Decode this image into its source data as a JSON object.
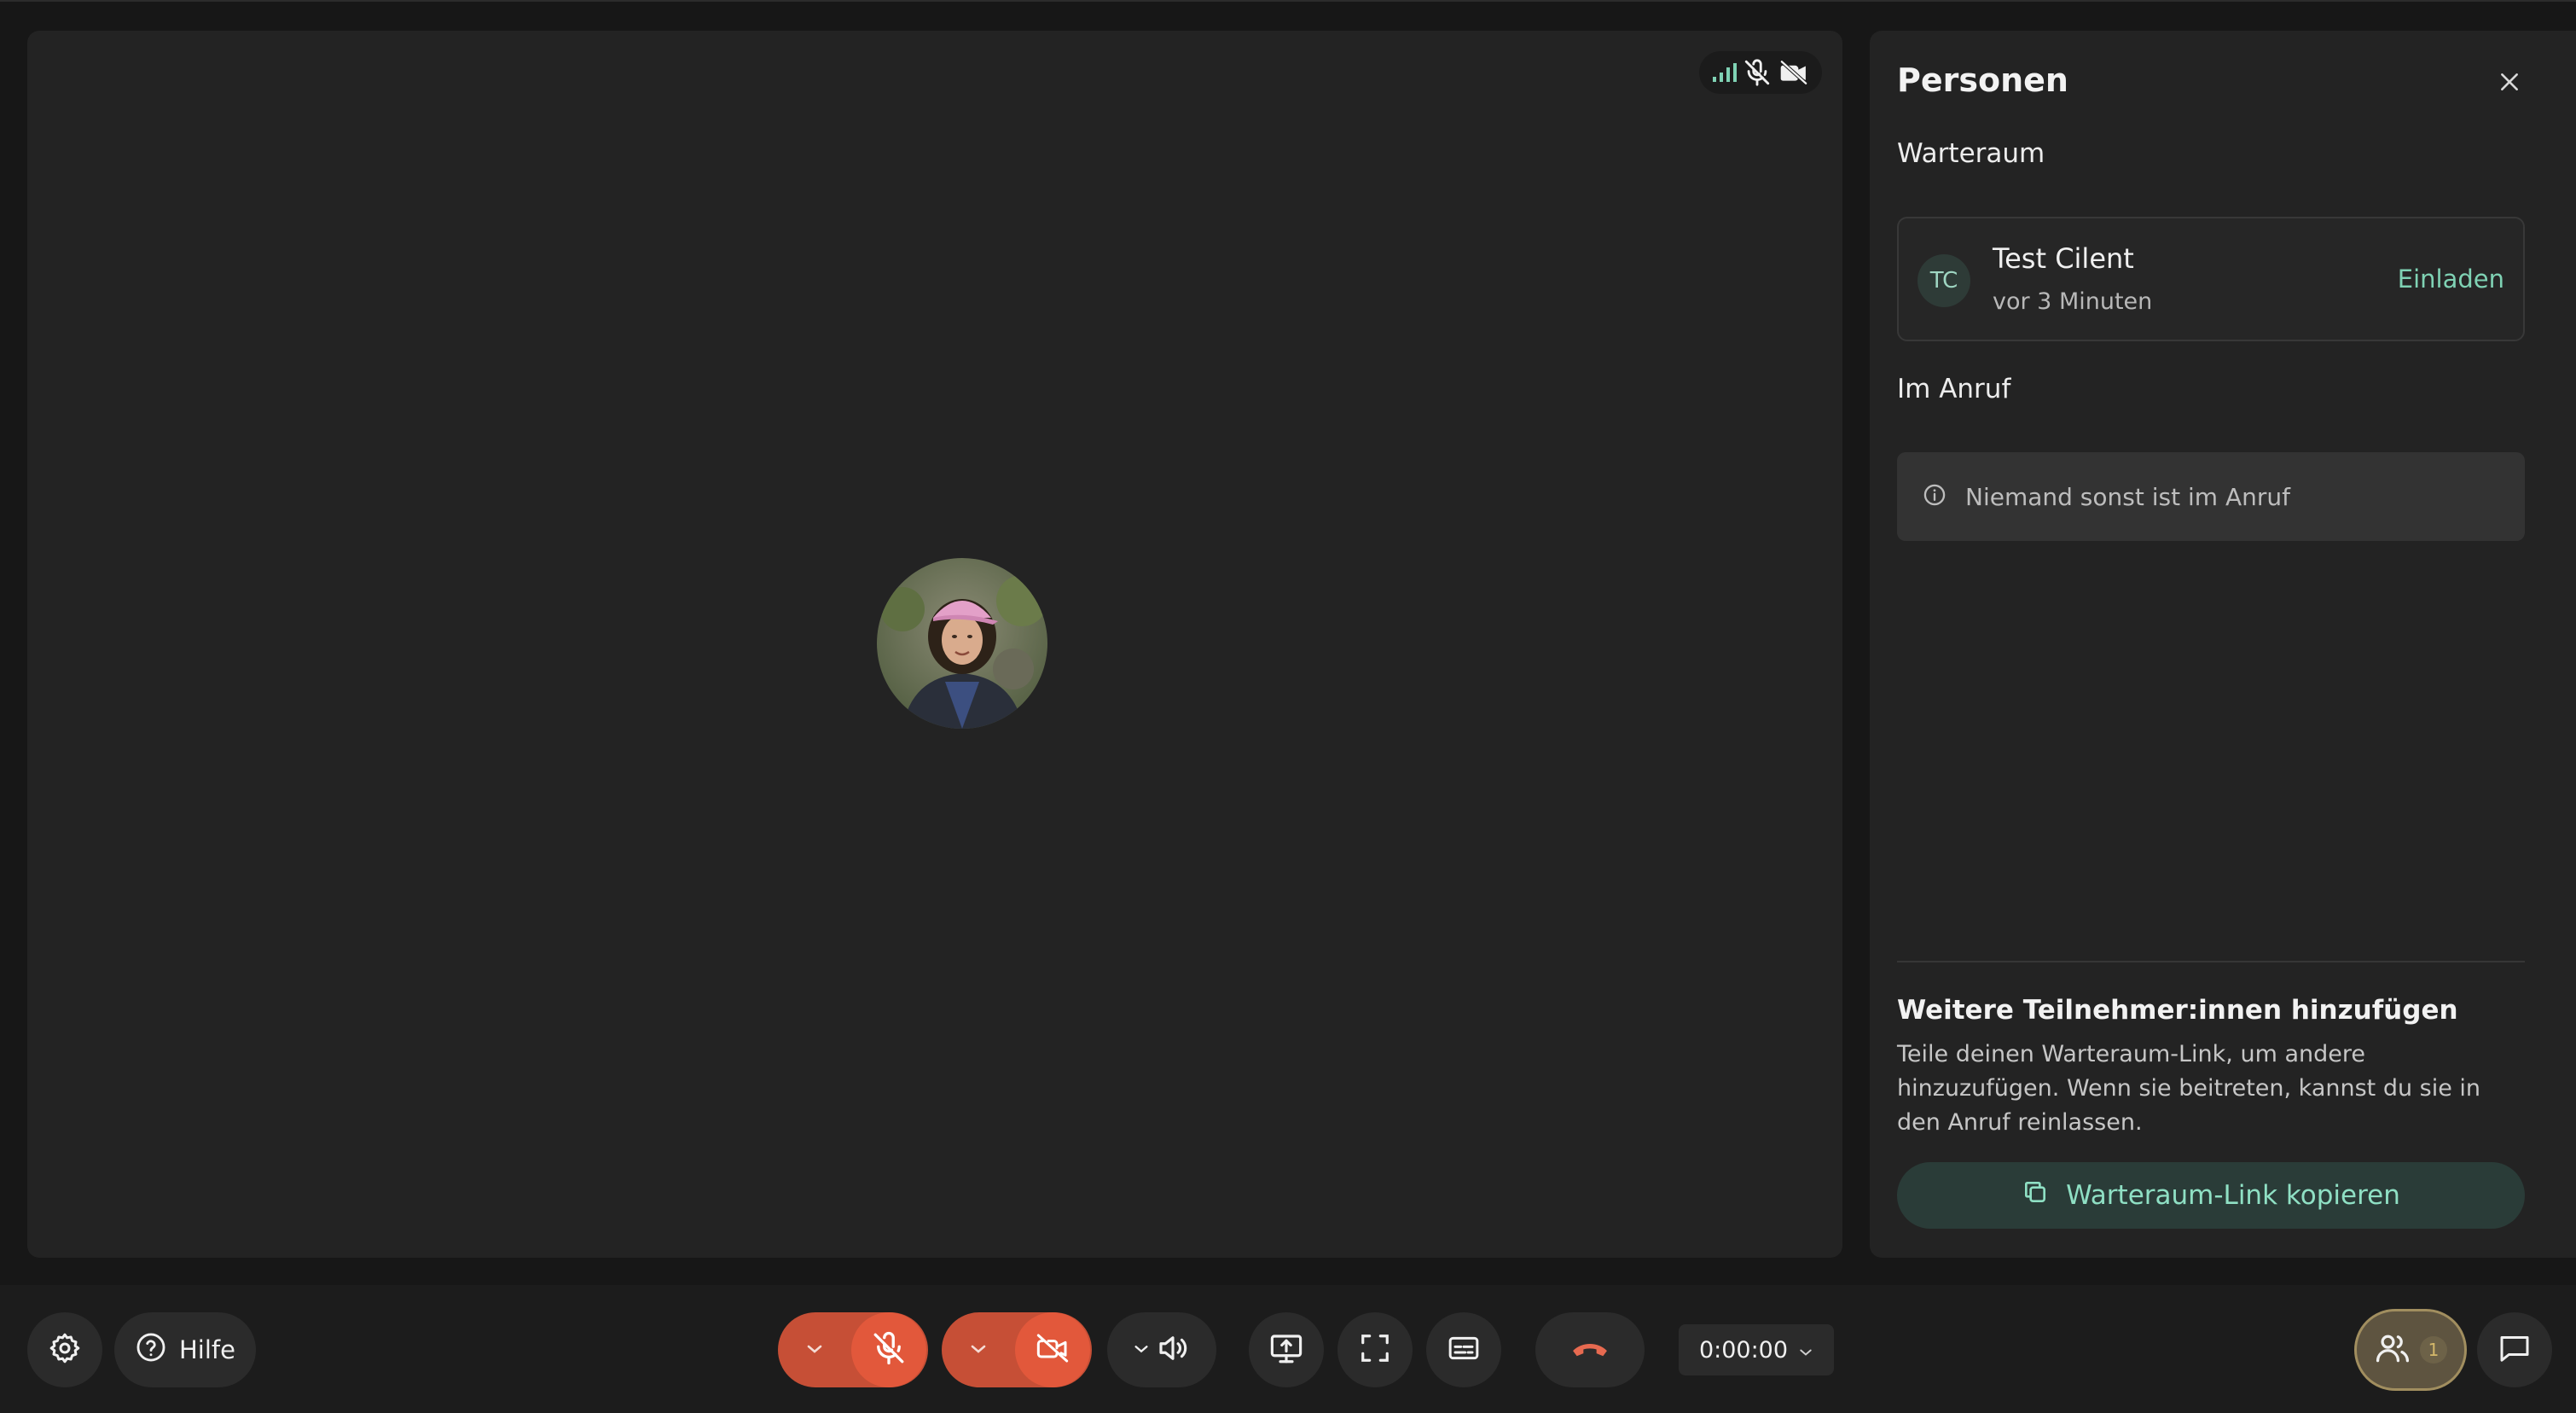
{
  "panel": {
    "title": "Personen",
    "waiting_room": {
      "label": "Warteraum",
      "participant": {
        "initials": "TC",
        "name": "Test Cilent",
        "time": "vor 3 Minuten",
        "invite_label": "Einladen"
      }
    },
    "in_call": {
      "label": "Im Anruf",
      "empty_message": "Niemand sonst ist im Anruf"
    },
    "add_participants": {
      "title": "Weitere Teilnehmer:innen hinzufügen",
      "description": "Teile deinen Warteraum-Link, um andere hinzuzufügen. Wenn sie beitreten, kannst du sie in den Anruf reinlassen.",
      "copy_button_label": "Warteraum-Link kopieren"
    }
  },
  "controls": {
    "help_label": "Hilfe",
    "timer": "0:00:00",
    "people_count": "1"
  },
  "icons": {
    "settings": "gear-icon",
    "help": "question-circle-icon",
    "mic": "mic-off-icon",
    "camera": "camera-off-icon",
    "speaker": "speaker-icon",
    "screen_share": "screen-share-icon",
    "fullscreen": "fullscreen-icon",
    "captions": "captions-icon",
    "hangup": "phone-hangup-icon",
    "people": "people-icon",
    "chat": "chat-icon",
    "close": "close-icon",
    "info": "info-icon",
    "copy": "copy-icon",
    "signal": "signal-icon"
  },
  "colors": {
    "accent": "#8fe0c4",
    "danger": "#e2583b",
    "signal": "#7fd2b4",
    "people_button_border": "#a18e5f"
  }
}
